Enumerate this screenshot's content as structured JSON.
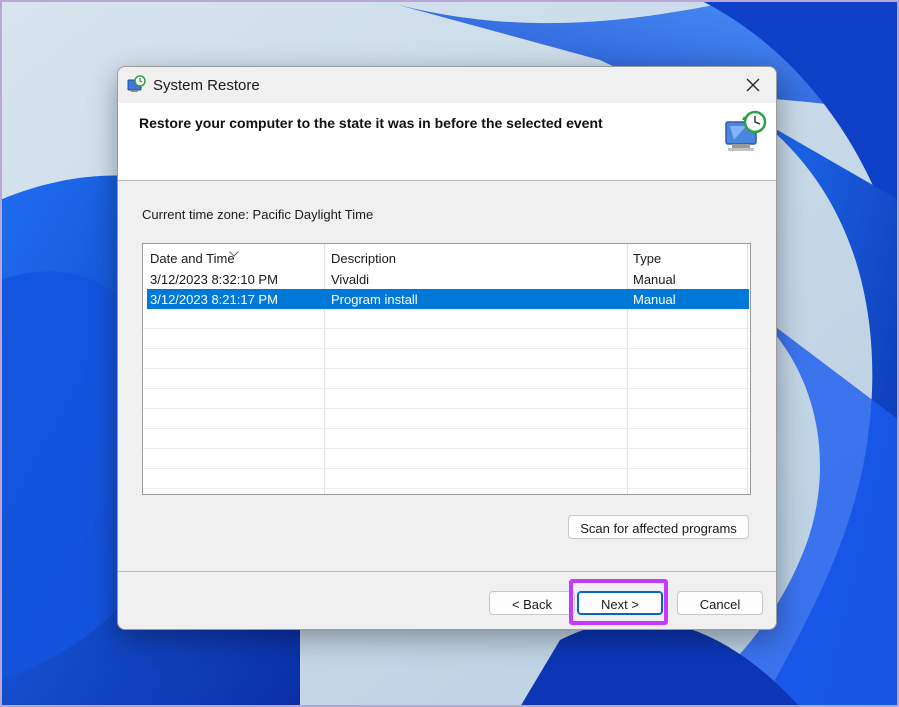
{
  "window": {
    "title": "System Restore",
    "header": "Restore your computer to the state it was in before the selected event"
  },
  "timezone_label": "Current time zone: Pacific Daylight Time",
  "table": {
    "columns": [
      "Date and Time",
      "Description",
      "Type"
    ],
    "rows": [
      {
        "date": "3/12/2023 8:32:10 PM",
        "description": "Vivaldi",
        "type": "Manual",
        "selected": false
      },
      {
        "date": "3/12/2023 8:21:17 PM",
        "description": "Program install",
        "type": "Manual",
        "selected": true
      }
    ]
  },
  "buttons": {
    "scan": "Scan for affected programs",
    "back": "< Back",
    "next": "Next >",
    "cancel": "Cancel"
  },
  "colors": {
    "selection": "#0078d7",
    "highlight_box": "#c63aff",
    "accent": "#0067c0"
  },
  "icons": {
    "app": "system-restore-icon",
    "close": "close-icon",
    "header": "restore-monitor-icon",
    "sort": "sort-down-icon"
  }
}
